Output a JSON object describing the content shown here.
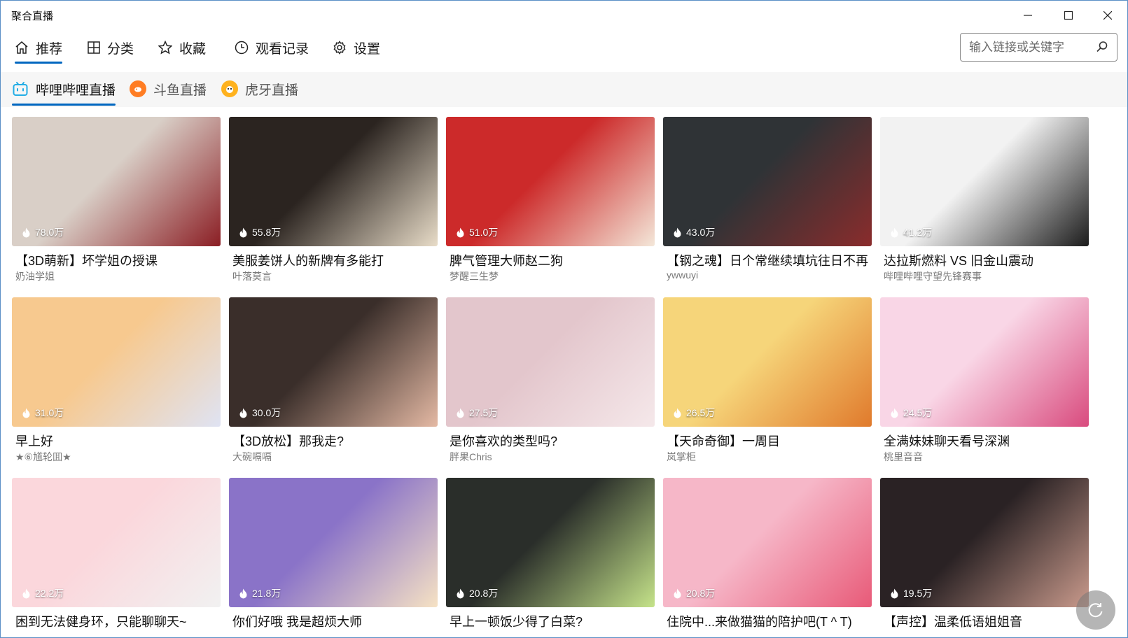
{
  "app": {
    "title": "聚合直播"
  },
  "window_controls": {
    "minimize": "minimize-icon",
    "maximize": "maximize-icon",
    "close": "close-icon"
  },
  "nav": [
    {
      "label": "推荐",
      "icon": "home-icon",
      "active": true
    },
    {
      "label": "分类",
      "icon": "grid-icon",
      "active": false
    },
    {
      "label": "收藏",
      "icon": "star-icon",
      "active": false
    },
    {
      "label": "观看记录",
      "icon": "clock-icon",
      "active": false
    },
    {
      "label": "设置",
      "icon": "gear-icon",
      "active": false
    }
  ],
  "search": {
    "placeholder": "输入链接或关键字",
    "value": ""
  },
  "platforms": [
    {
      "label": "哔哩哔哩直播",
      "icon": "bilibili-logo",
      "active": true,
      "color": "#23ade5"
    },
    {
      "label": "斗鱼直播",
      "icon": "douyu-logo",
      "active": false,
      "color": "#ff7d23"
    },
    {
      "label": "虎牙直播",
      "icon": "huya-logo",
      "active": false,
      "color": "#ffa500"
    }
  ],
  "rooms": [
    {
      "title": "【3D萌新】坏学姐の授课",
      "user": "奶油学姐",
      "viewers": "78.0万",
      "thumb_colors": [
        "#d9cfc7",
        "#8b1e24"
      ]
    },
    {
      "title": "美服姜饼人的新牌有多能打",
      "user": "叶落莫言",
      "viewers": "55.8万",
      "thumb_colors": [
        "#2b2420",
        "#e8dcc8"
      ]
    },
    {
      "title": "脾气管理大师赵二狗",
      "user": "梦醒三生梦",
      "viewers": "51.0万",
      "thumb_colors": [
        "#cc2a2a",
        "#f4e7d9"
      ]
    },
    {
      "title": "【钢之魂】日个常继续填坑往日不再",
      "user": "ywwuyi",
      "viewers": "43.0万",
      "thumb_colors": [
        "#2f3336",
        "#8a2c2c"
      ]
    },
    {
      "title": "达拉斯燃料 VS 旧金山震动",
      "user": "哔哩哔哩守望先锋赛事",
      "viewers": "41.2万",
      "thumb_colors": [
        "#f2f2f2",
        "#1c1c1c"
      ]
    },
    {
      "title": "早上好",
      "user": "★⑥馗轮囬★",
      "viewers": "31.0万",
      "thumb_colors": [
        "#f7c98f",
        "#dfe3f3"
      ]
    },
    {
      "title": "【3D放松】那我走?",
      "user": "大碗嗝嗝",
      "viewers": "30.0万",
      "thumb_colors": [
        "#3a2e2a",
        "#e4b9a4"
      ]
    },
    {
      "title": "是你喜欢的类型吗?",
      "user": "胖果Chris",
      "viewers": "27.5万",
      "thumb_colors": [
        "#e3c6cc",
        "#f5e8ea"
      ]
    },
    {
      "title": "【天命奇御】一周目",
      "user": "岚掌柜",
      "viewers": "26.5万",
      "thumb_colors": [
        "#f6d57a",
        "#e07a2c"
      ]
    },
    {
      "title": "全满妹妹聊天看号深渊",
      "user": "桃里音音",
      "viewers": "24.5万",
      "thumb_colors": [
        "#f9d6e6",
        "#d94b7e"
      ]
    },
    {
      "title": "困到无法健身环，只能聊聊天~",
      "user": "",
      "viewers": "22.2万",
      "thumb_colors": [
        "#fbd7dc",
        "#f1f1f1"
      ]
    },
    {
      "title": "你们好哦 我是超烦大师",
      "user": "",
      "viewers": "21.8万",
      "thumb_colors": [
        "#8a73c8",
        "#f6e2c4"
      ]
    },
    {
      "title": "早上一顿饭少得了白菜?",
      "user": "",
      "viewers": "20.8万",
      "thumb_colors": [
        "#2a2e2a",
        "#c5e38a"
      ]
    },
    {
      "title": "住院中...来做猫猫的陪护吧(T ^ T)",
      "user": "",
      "viewers": "20.8万",
      "thumb_colors": [
        "#f6b7c8",
        "#e85a78"
      ]
    },
    {
      "title": "【声控】温柔低语姐姐音",
      "user": "",
      "viewers": "19.5万",
      "thumb_colors": [
        "#2a2224",
        "#c99a8c"
      ]
    }
  ],
  "refresh": {
    "icon": "refresh-icon"
  }
}
